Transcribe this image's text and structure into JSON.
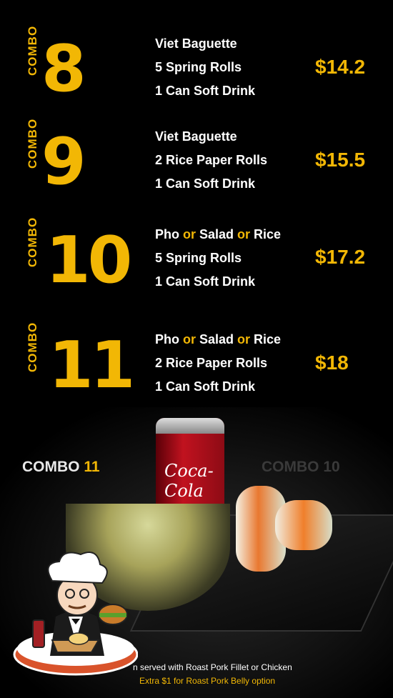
{
  "combos": [
    {
      "label": "COMBO",
      "number": "8",
      "items": [
        [
          "Viet Baguette"
        ],
        [
          "5 Spring Rolls"
        ],
        [
          "1 Can Soft Drink"
        ]
      ],
      "price": "$14.2"
    },
    {
      "label": "COMBO",
      "number": "9",
      "items": [
        [
          "Viet Baguette"
        ],
        [
          "2 Rice Paper Rolls"
        ],
        [
          "1 Can Soft Drink"
        ]
      ],
      "price": "$15.5"
    },
    {
      "label": "COMBO",
      "number": "10",
      "items": [
        [
          "Pho ",
          "or",
          " Salad ",
          "or",
          " Rice"
        ],
        [
          "5 Spring Rolls"
        ],
        [
          "1 Can Soft Drink"
        ]
      ],
      "price": "$17.2"
    },
    {
      "label": "COMBO",
      "number": "11",
      "items": [
        [
          "Pho ",
          "or",
          " Salad ",
          "or",
          " Rice"
        ],
        [
          "2 Rice Paper Rolls"
        ],
        [
          "1 Can Soft Drink"
        ]
      ],
      "price": "$18"
    }
  ],
  "photo": {
    "left_label": {
      "word": "COMBO",
      "number": "11"
    },
    "right_label": "COMBO 10",
    "can_text": "Coca-Cola"
  },
  "footnotes": [
    "n served with Roast Pork Fillet or Chicken",
    "Extra $1 for Roast Pork Belly option"
  ],
  "colors": {
    "accent": "#f2b705",
    "background": "#000000"
  },
  "icons": [
    "chef-mascot-icon"
  ]
}
